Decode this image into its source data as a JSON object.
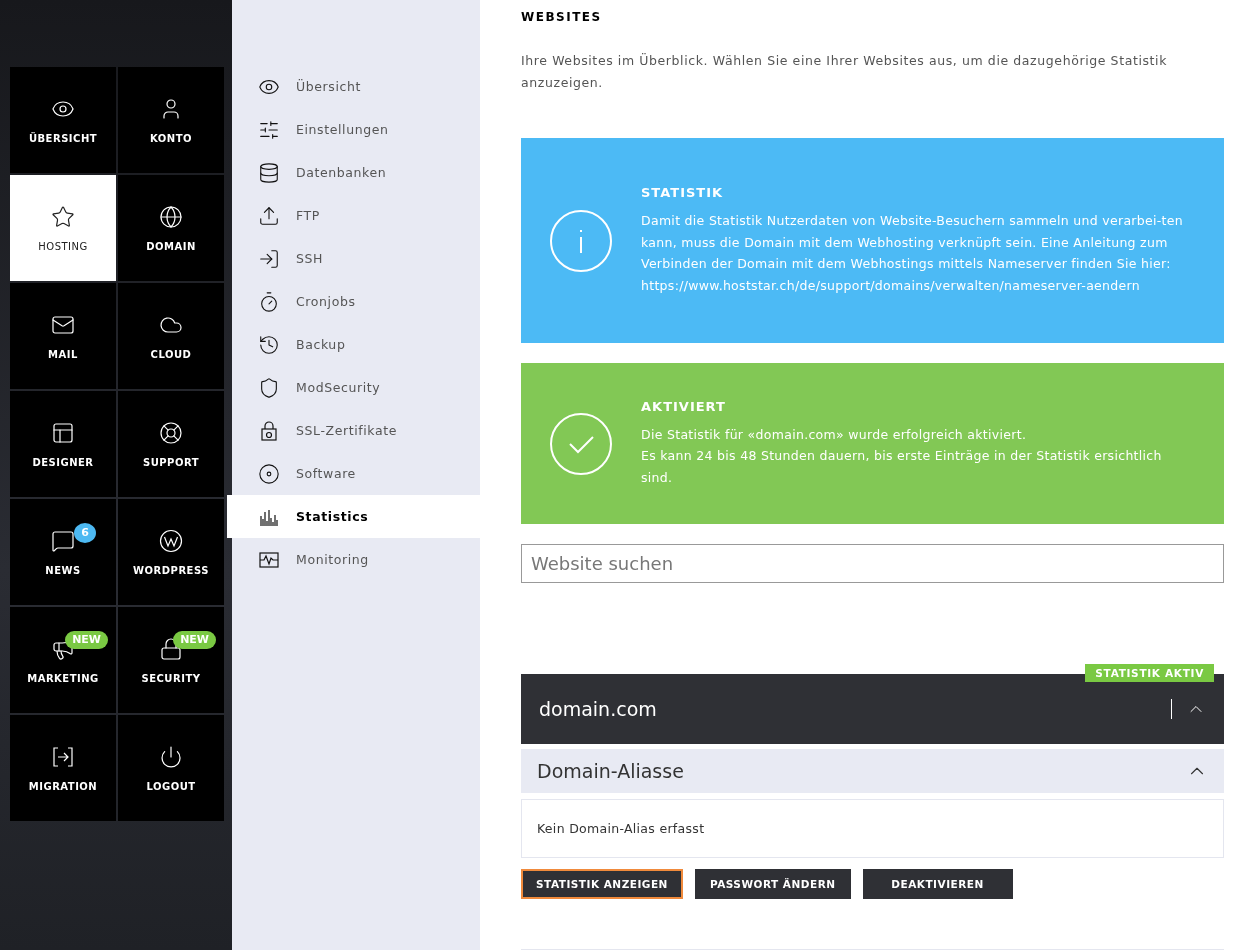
{
  "tiles": [
    {
      "label": "ÜBERSICHT",
      "selected": false
    },
    {
      "label": "KONTO",
      "selected": false
    },
    {
      "label": "HOSTING",
      "selected": true
    },
    {
      "label": "DOMAIN",
      "selected": false
    },
    {
      "label": "MAIL",
      "selected": false
    },
    {
      "label": "CLOUD",
      "selected": false
    },
    {
      "label": "DESIGNER",
      "selected": false
    },
    {
      "label": "SUPPORT",
      "selected": false
    },
    {
      "label": "NEWS",
      "selected": false,
      "badge": {
        "text": "6",
        "kind": "count"
      }
    },
    {
      "label": "WORDPRESS",
      "selected": false
    },
    {
      "label": "MARKETING",
      "selected": false,
      "badge": {
        "text": "NEW",
        "kind": "new"
      }
    },
    {
      "label": "SECURITY",
      "selected": false,
      "badge": {
        "text": "NEW",
        "kind": "new"
      }
    },
    {
      "label": "MIGRATION",
      "selected": false
    },
    {
      "label": "LOGOUT",
      "selected": false
    }
  ],
  "subnav": [
    {
      "label": "Übersicht",
      "selected": false
    },
    {
      "label": "Einstellungen",
      "selected": false
    },
    {
      "label": "Datenbanken",
      "selected": false
    },
    {
      "label": "FTP",
      "selected": false
    },
    {
      "label": "SSH",
      "selected": false
    },
    {
      "label": "Cronjobs",
      "selected": false
    },
    {
      "label": "Backup",
      "selected": false
    },
    {
      "label": "ModSecurity",
      "selected": false
    },
    {
      "label": "SSL-Zertifikate",
      "selected": false
    },
    {
      "label": "Software",
      "selected": false
    },
    {
      "label": "Statistics",
      "selected": true
    },
    {
      "label": "Monitoring",
      "selected": false
    }
  ],
  "heading": "WEBSITES",
  "intro": "Ihre Websites im Überblick. Wählen Sie eine Ihrer Websites aus, um die dazugehörige Statistik anzuzeigen.",
  "notices": [
    {
      "kind": "info",
      "title": "STATISTIK",
      "lines": [
        "Damit die Statistik Nutzerdaten von Website-Besuchern sammeln und verarbei-ten kann, muss die Domain mit dem Webhosting verknüpft sein. Eine Anleitung zum Verbinden der Domain mit dem Webhostings mittels Nameserver finden Sie hier: https://www.hoststar.ch/de/support/domains/verwalten/nameserver-aendern"
      ]
    },
    {
      "kind": "success",
      "title": "AKTIVIERT",
      "lines": [
        "Die Statistik für «domain.com» wurde erfolgreich aktiviert.",
        "Es kann 24 bis 48 Stunden dauern, bis erste Einträge in der Statistik ersichtlich sind."
      ]
    }
  ],
  "search": {
    "placeholder": "Website suchen"
  },
  "website": {
    "name": "domain.com",
    "status": "STATISTIK AKTIV",
    "expanded": true,
    "aliases": {
      "title": "Domain-Aliasse",
      "expanded": true,
      "empty_text": "Kein Domain-Alias erfasst"
    },
    "buttons": [
      {
        "label": "STATISTIK ANZEIGEN",
        "focused": true
      },
      {
        "label": "PASSWORT ÄNDERN",
        "focused": false
      },
      {
        "label": "DEAKTIVIEREN",
        "focused": false
      }
    ]
  }
}
